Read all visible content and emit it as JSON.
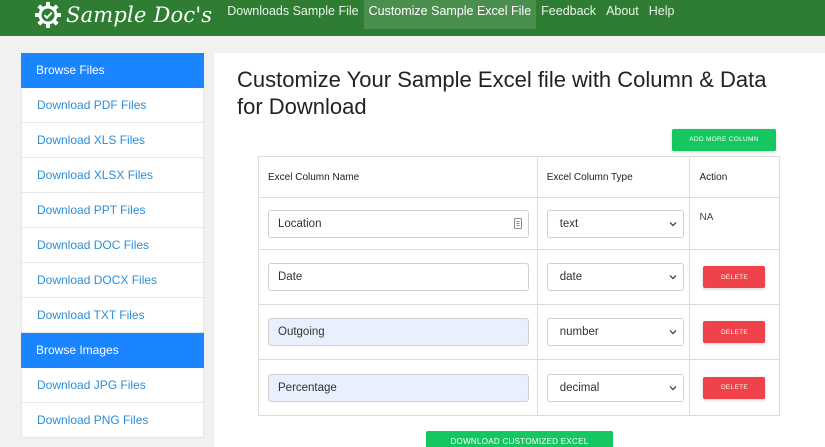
{
  "brand": {
    "name": "Sample Doc's"
  },
  "nav": {
    "items": [
      {
        "label": "Downloads Sample File",
        "active": false
      },
      {
        "label": "Customize Sample Excel File",
        "active": true
      },
      {
        "label": "Feedback",
        "active": false
      },
      {
        "label": "About",
        "active": false
      },
      {
        "label": "Help",
        "active": false
      }
    ]
  },
  "sidebar": {
    "files_header": "Browse Files",
    "files": [
      "Download PDF Files",
      "Download XLS Files",
      "Download XLSX Files",
      "Download PPT Files",
      "Download DOC Files",
      "Download DOCX Files",
      "Download TXT Files"
    ],
    "images_header": "Browse Images",
    "images": [
      "Download JPG Files",
      "Download PNG Files"
    ]
  },
  "main": {
    "title": "Customize Your Sample Excel file with Column & Data for Download",
    "add_column_label": "ADD MORE COLUMN",
    "table": {
      "headers": [
        "Excel Column Name",
        "Excel Column Type",
        "Action"
      ],
      "rows": [
        {
          "name": "Location",
          "type": "text",
          "action": "NA"
        },
        {
          "name": "Date",
          "type": "date",
          "action": "DELETE"
        },
        {
          "name": "Outgoing",
          "type": "number",
          "action": "DELETE"
        },
        {
          "name": "Percentage",
          "type": "decimal",
          "action": "DELETE"
        }
      ]
    },
    "download_label": "DOWNLOAD CUSTOMIZED EXCEL"
  },
  "colors": {
    "navbar": "#2e7d32",
    "sidebar_header": "#1a85ff",
    "link": "#2d8ed9",
    "add_button": "#14c760",
    "delete_button": "#f0424a",
    "autofill_bg": "#e8f0fe"
  },
  "icons": {
    "logo": "gear-logo-icon",
    "input_keyboard": "keyboard-icon",
    "select_arrow": "chevron-down-icon"
  }
}
